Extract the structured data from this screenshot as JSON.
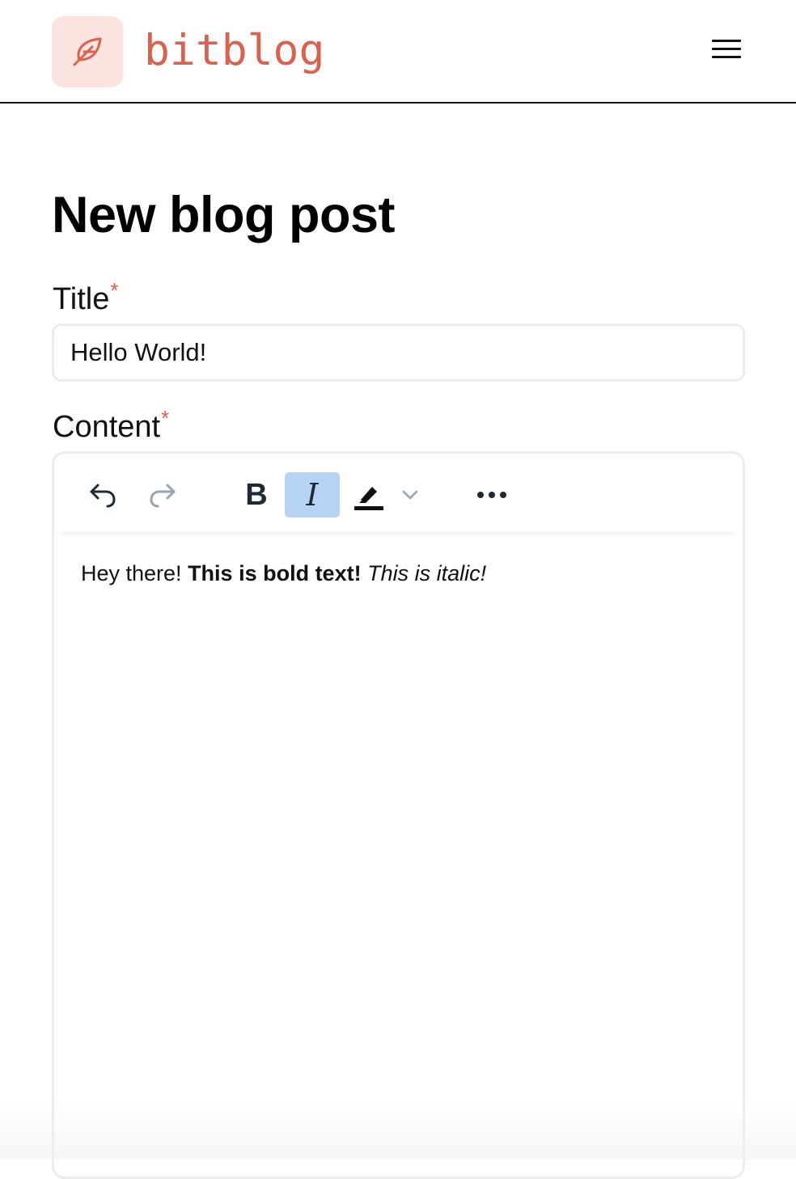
{
  "header": {
    "brand": "bitblog",
    "logo_icon": "feather-icon",
    "menu_icon": "hamburger-menu-icon",
    "accent_color": "#d9624f",
    "logo_bg_color": "#fbe3e0"
  },
  "page": {
    "title": "New blog post"
  },
  "form": {
    "title_label": "Title",
    "title_required": "*",
    "title_value": "Hello World!",
    "content_label": "Content",
    "content_required": "*"
  },
  "toolbar": {
    "undo_icon": "undo-icon",
    "redo_icon": "redo-icon",
    "bold_label": "B",
    "italic_label": "I",
    "italic_active": true,
    "highlight_icon": "highlighter-icon",
    "highlight_dropdown_icon": "chevron-down-icon",
    "more_icon": "more-horizontal-icon",
    "active_color": "#b7d3f4"
  },
  "editor": {
    "segments": [
      {
        "text": "Hey there! ",
        "style": "normal"
      },
      {
        "text": "This is bold text!",
        "style": "bold"
      },
      {
        "text": " ",
        "style": "normal"
      },
      {
        "text": "This is italic!",
        "style": "italic"
      }
    ]
  }
}
